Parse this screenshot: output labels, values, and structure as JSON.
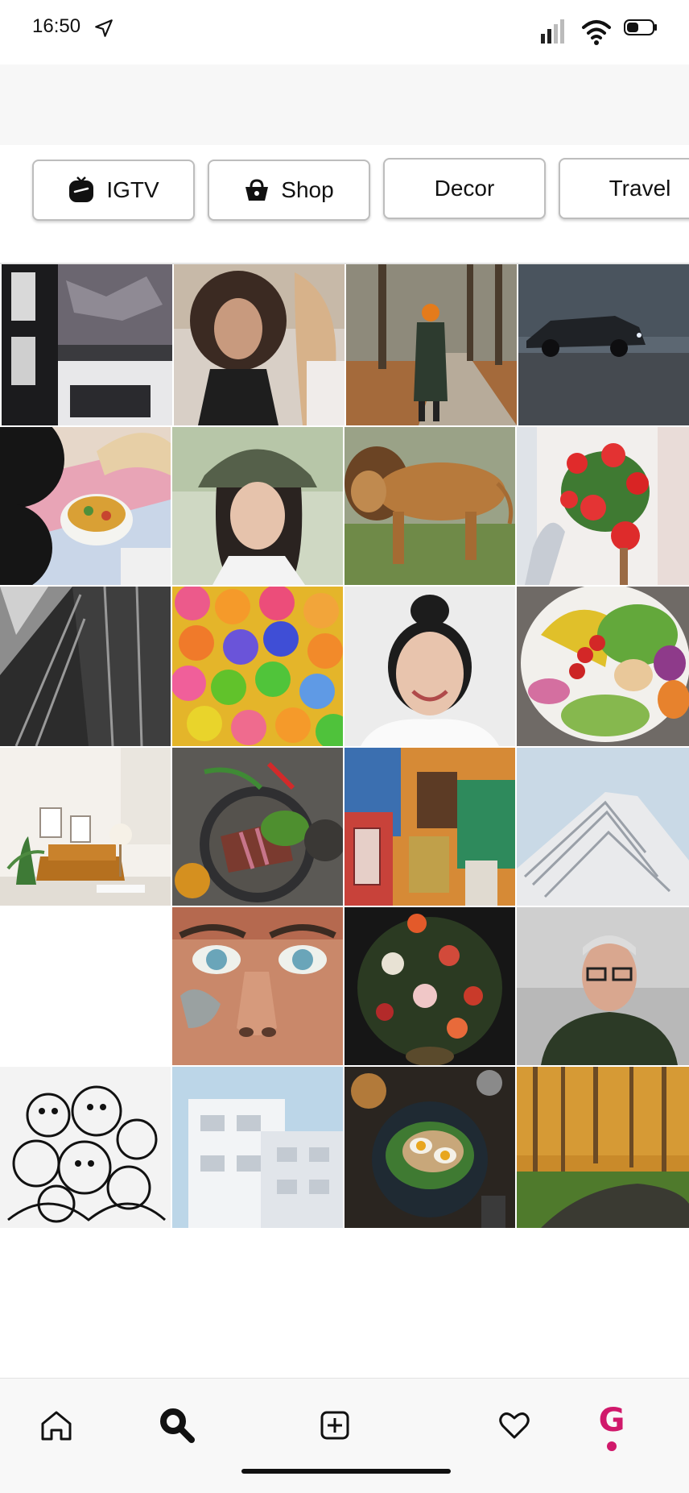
{
  "status_bar": {
    "time": "16:50"
  },
  "chips": [
    {
      "label": "IGTV",
      "icon": "igtv-icon"
    },
    {
      "label": "Shop",
      "icon": "shop-bag-icon"
    },
    {
      "label": "Decor",
      "icon": ""
    },
    {
      "label": "Travel",
      "icon": ""
    }
  ],
  "grid": {
    "tiles": [
      "architecture-interior",
      "woman-curly-hair",
      "person-autumn-path",
      "dark-car",
      "records-guitar-food",
      "woman-bucket-hat",
      "lion-walking",
      "red-roses",
      "bw-skyscraper",
      "colorful-balls",
      "smiling-woman",
      "salad-bowl",
      "living-room",
      "steak-plate",
      "painted-wall",
      "white-pyramid-building",
      "blank",
      "face-mural",
      "flower-painting",
      "man-glasses",
      "doodle-drawing",
      "white-building",
      "egg-avocado-toast",
      "autumn-forest"
    ]
  },
  "bottom_nav": {
    "items": [
      {
        "name": "home",
        "icon": "home-icon"
      },
      {
        "name": "search",
        "icon": "search-icon"
      },
      {
        "name": "add",
        "icon": "add-post-icon"
      },
      {
        "name": "activity",
        "icon": "heart-icon"
      },
      {
        "name": "profile",
        "icon": "profile-icon",
        "letter": "G"
      }
    ]
  },
  "colors": {
    "accent": "#d0196b",
    "background": "#ffffff",
    "nav_background": "#f8f8f8"
  }
}
